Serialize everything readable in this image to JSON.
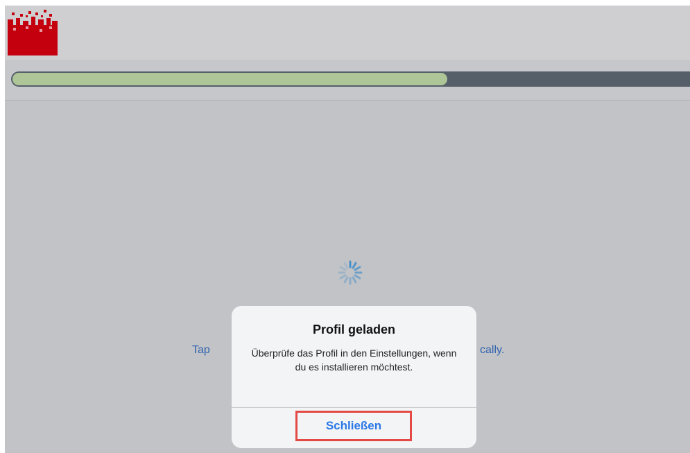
{
  "progress": {
    "value_percent": 64
  },
  "background": {
    "tap_text_left": "Tap",
    "tap_text_right": "cally."
  },
  "dialog": {
    "title": "Profil geladen",
    "message": "Überprüfe das Profil in den Einstellungen, wenn du es installieren möchtest.",
    "button_label": "Schließen"
  },
  "colors": {
    "logo": "#c4000f",
    "progress_fill": "#aec597",
    "progress_track": "#555f69",
    "button_text": "#2a78e6",
    "highlight": "#e34a46"
  },
  "icons": {
    "logo": "brand-logo-icon",
    "spinner": "loading-spinner-icon"
  }
}
